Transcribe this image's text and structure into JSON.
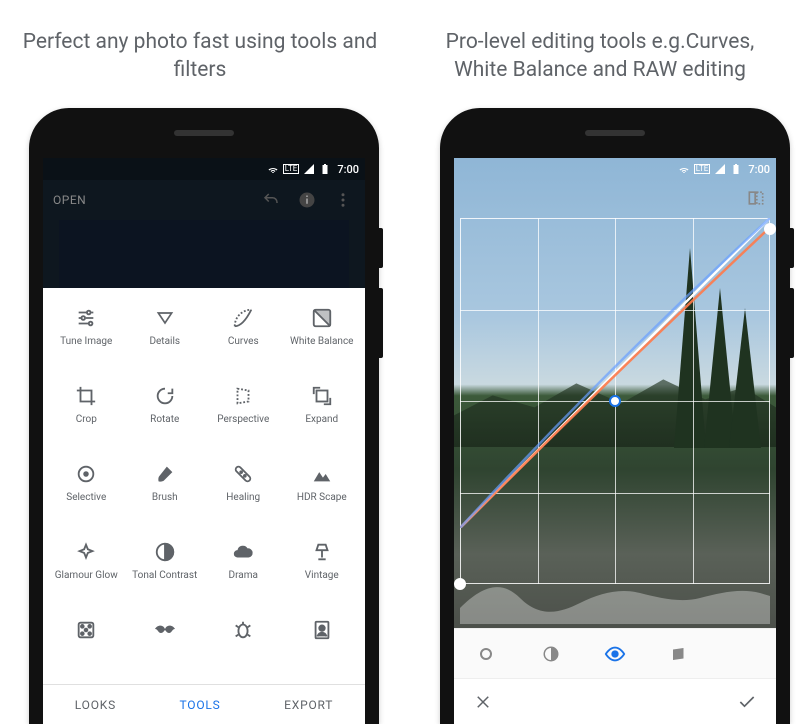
{
  "captions": {
    "left": "Perfect any photo fast using tools and filters",
    "right": "Pro-level editing tools e.g.Curves, White Balance and RAW editing"
  },
  "status": {
    "time": "7:00",
    "network": "LTE"
  },
  "left_screen": {
    "open_label": "OPEN",
    "tools": [
      {
        "label": "Tune Image",
        "icon": "sliders"
      },
      {
        "label": "Details",
        "icon": "triangle-down"
      },
      {
        "label": "Curves",
        "icon": "curve"
      },
      {
        "label": "White Balance",
        "icon": "wb"
      },
      {
        "label": "Crop",
        "icon": "crop"
      },
      {
        "label": "Rotate",
        "icon": "rotate"
      },
      {
        "label": "Perspective",
        "icon": "perspective"
      },
      {
        "label": "Expand",
        "icon": "expand"
      },
      {
        "label": "Selective",
        "icon": "target"
      },
      {
        "label": "Brush",
        "icon": "brush"
      },
      {
        "label": "Healing",
        "icon": "bandage"
      },
      {
        "label": "HDR Scape",
        "icon": "mountains"
      },
      {
        "label": "Glamour Glow",
        "icon": "sparkle"
      },
      {
        "label": "Tonal Contrast",
        "icon": "half-circle"
      },
      {
        "label": "Drama",
        "icon": "cloud"
      },
      {
        "label": "Vintage",
        "icon": "lamp"
      }
    ],
    "tools_row5_icons": [
      "dice",
      "mustache",
      "guitar",
      "portrait"
    ],
    "nav": {
      "looks": "LOOKS",
      "tools": "TOOLS",
      "export": "EXPORT"
    }
  },
  "right_screen": {
    "curves": {
      "channels": [
        "luminance",
        "contrast",
        "eye",
        "red",
        "green",
        "blue"
      ],
      "selected_index": 2,
      "nodes": [
        {
          "x": 0.0,
          "y": 1.0
        },
        {
          "x": 0.5,
          "y": 0.5
        },
        {
          "x": 1.0,
          "y": 0.03
        }
      ]
    },
    "action_icons": [
      "close",
      "neutral",
      "channel",
      "check"
    ]
  },
  "colors": {
    "accent": "#1a73e8",
    "muted": "#5f6368"
  }
}
